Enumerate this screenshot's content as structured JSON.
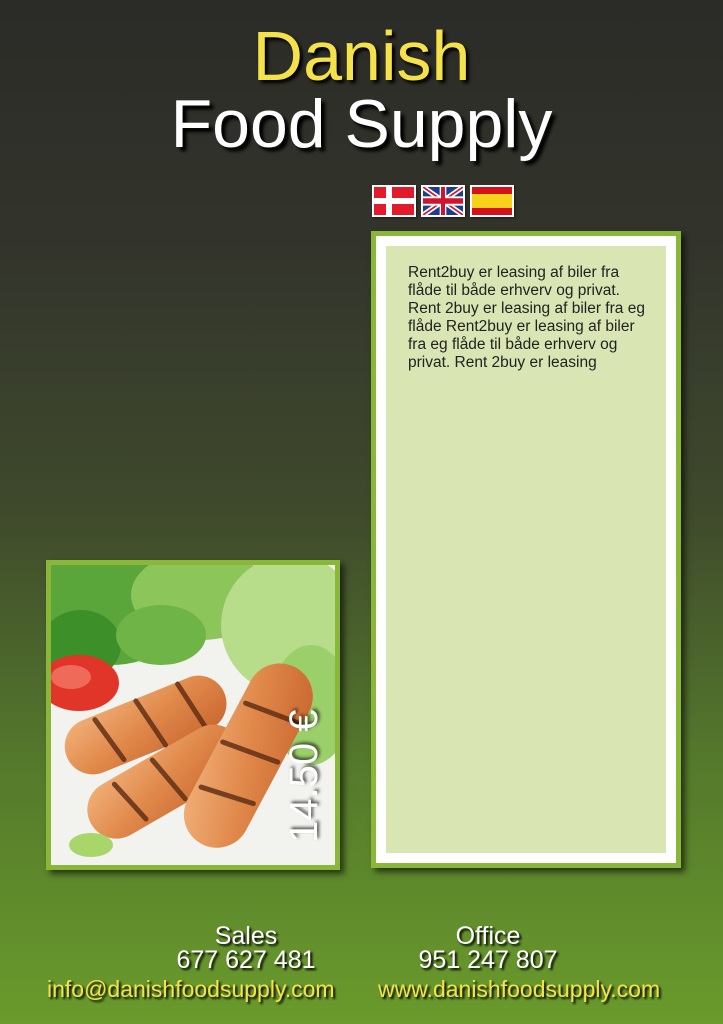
{
  "header": {
    "title_line1": "Danish",
    "title_line2": "Food Supply"
  },
  "languages": [
    {
      "name": "danish-flag-icon",
      "colors": [
        "#e21b2c",
        "#ffffff"
      ]
    },
    {
      "name": "uk-flag-icon",
      "colors": [
        "#1b3f8f",
        "#ffffff",
        "#d0142a"
      ]
    },
    {
      "name": "spain-flag-icon",
      "colors": [
        "#d5121a",
        "#f7d21a"
      ]
    }
  ],
  "description": {
    "text": "Rent2buy er leasing af biler fra flåde til både erhverv og privat. Rent 2buy er leasing af biler fra eg flåde Rent2buy er leasing af biler fra eg flåde til både erhverv og privat. Rent 2buy er leasing"
  },
  "product": {
    "price": "14.50 €"
  },
  "contact": {
    "sales_label": "Sales",
    "sales_phone": "677 627 481",
    "sales_email": "info@danishfoodsupply.com",
    "office_label": "Office",
    "office_phone": "951 247 807",
    "office_website": "www.danishfoodsupply.com"
  },
  "colors": {
    "accent_yellow": "#f5e24a",
    "panel_green": "#8ab63a",
    "panel_fill": "#d9e5b3"
  }
}
